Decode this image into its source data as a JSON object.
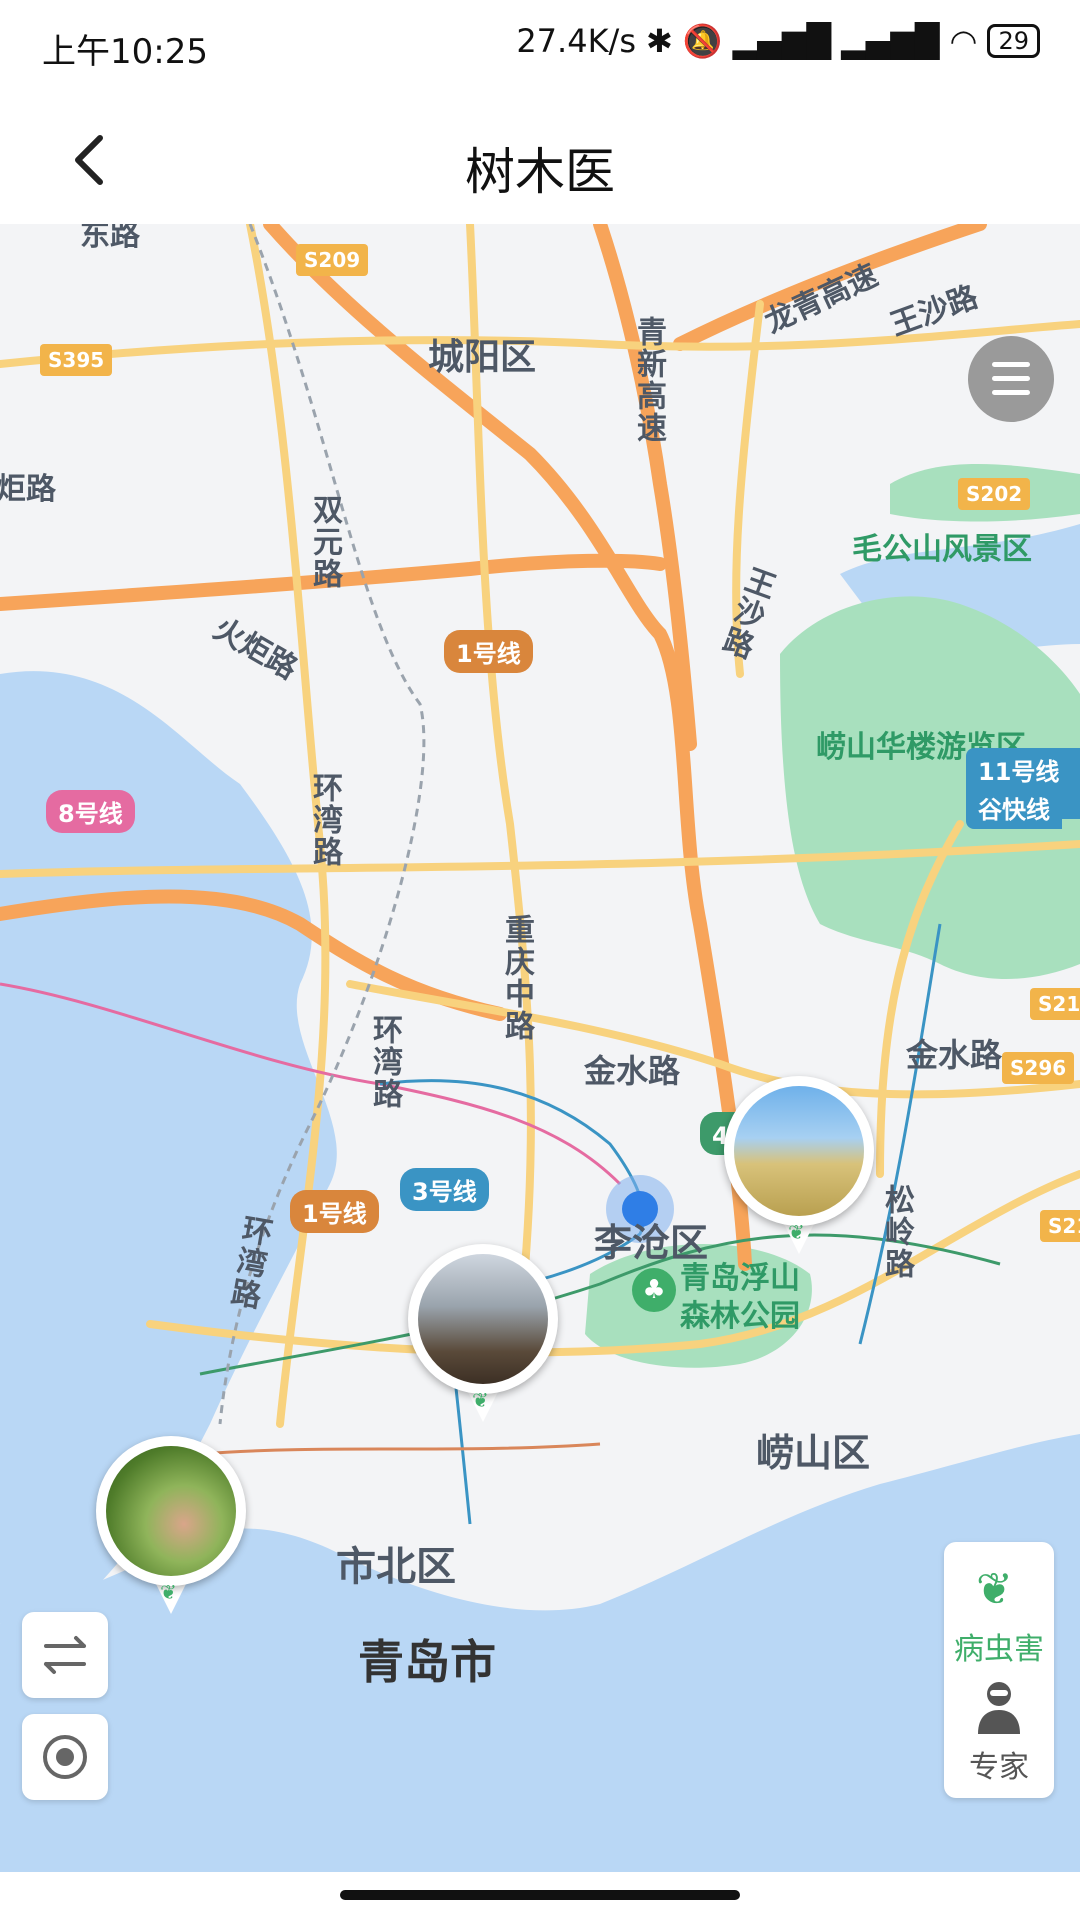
{
  "status": {
    "time": "上午10:25",
    "net_speed": "27.4K/s",
    "battery": "29"
  },
  "header": {
    "title": "树木医"
  },
  "map": {
    "districts": [
      "城阳区",
      "李沧区",
      "崂山区",
      "市北区",
      "青岛市"
    ],
    "roads": [
      "龙青高速",
      "王沙路",
      "青新高速",
      "双元路",
      "王沙路",
      "火炬路",
      "环湾路",
      "重庆中路",
      "环湾路",
      "金水路",
      "金水路",
      "松岭路",
      "环湾路",
      "炬路"
    ],
    "shields": [
      "S209",
      "S395",
      "S202",
      "S296",
      "S21",
      "S21"
    ],
    "pois": [
      "毛公山风景区",
      "崂山华楼游览区",
      "青岛浮山森林公园"
    ],
    "metro": [
      "1号线",
      "8号线",
      "11号线(",
      "谷快线",
      "1号线",
      "3号线",
      "4号线"
    ],
    "truncated_top": "东路"
  },
  "panel": {
    "pest_label": "病虫害",
    "expert_label": "专家"
  },
  "icons": {
    "menu": "menu-icon",
    "swap": "swap-icon",
    "locate": "locate-icon",
    "leaf": "leaf-icon",
    "expert": "expert-icon"
  },
  "colors": {
    "water": "#b9d7f5",
    "park": "#a8e0be",
    "expressway": "#f7a45a",
    "road": "#f8d27e",
    "metro_green": "#3d9a6a",
    "metro_blue": "#3a94c4",
    "metro_pink": "#e56ba1",
    "metro_orange": "#d9863c"
  }
}
